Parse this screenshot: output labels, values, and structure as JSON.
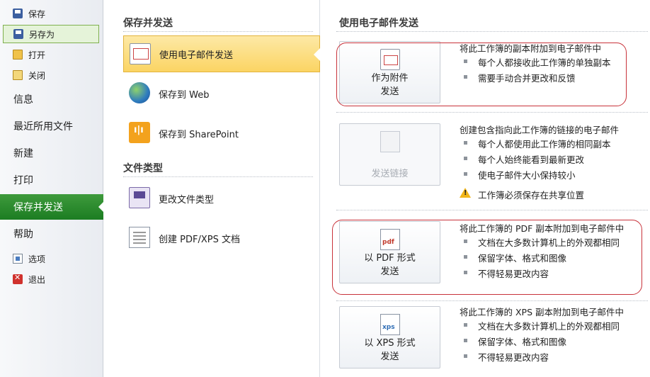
{
  "nav": {
    "save": "保存",
    "save_as": "另存为",
    "open": "打开",
    "close": "关闭",
    "info": "信息",
    "recent": "最近所用文件",
    "new": "新建",
    "print": "打印",
    "save_send": "保存并发送",
    "help": "帮助",
    "options": "选项",
    "exit": "退出"
  },
  "middle": {
    "section_save_send": "保存并发送",
    "items": [
      {
        "label": "使用电子邮件发送"
      },
      {
        "label": "保存到 Web"
      },
      {
        "label": "保存到 SharePoint"
      }
    ],
    "section_file_types": "文件类型",
    "file_items": [
      {
        "label": "更改文件类型"
      },
      {
        "label": "创建 PDF/XPS 文档"
      }
    ]
  },
  "right": {
    "title": "使用电子邮件发送",
    "options": [
      {
        "button": [
          "作为附件",
          "发送"
        ],
        "lead": "将此工作簿的副本附加到电子邮件中",
        "bullets": [
          "每个人都接收此工作簿的单独副本",
          "需要手动合并更改和反馈"
        ]
      },
      {
        "button": [
          "发送链接"
        ],
        "lead": "创建包含指向此工作簿的链接的电子邮件",
        "bullets": [
          "每个人都使用此工作簿的相同副本",
          "每个人始终能看到最新更改",
          "使电子邮件大小保持较小"
        ],
        "warning": "工作簿必须保存在共享位置"
      },
      {
        "button": [
          "以 PDF 形式",
          "发送"
        ],
        "lead": "将此工作簿的 PDF 副本附加到电子邮件中",
        "bullets": [
          "文档在大多数计算机上的外观都相同",
          "保留字体、格式和图像",
          "不得轻易更改内容"
        ]
      },
      {
        "button": [
          "以 XPS 形式",
          "发送"
        ],
        "lead": "将此工作簿的 XPS 副本附加到电子邮件中",
        "bullets": [
          "文档在大多数计算机上的外观都相同",
          "保留字体、格式和图像",
          "不得轻易更改内容"
        ]
      }
    ]
  },
  "colors": {
    "active_nav": "#2a8a2e",
    "active_item": "#fbd463",
    "annotation_oval": "#c8323a"
  }
}
